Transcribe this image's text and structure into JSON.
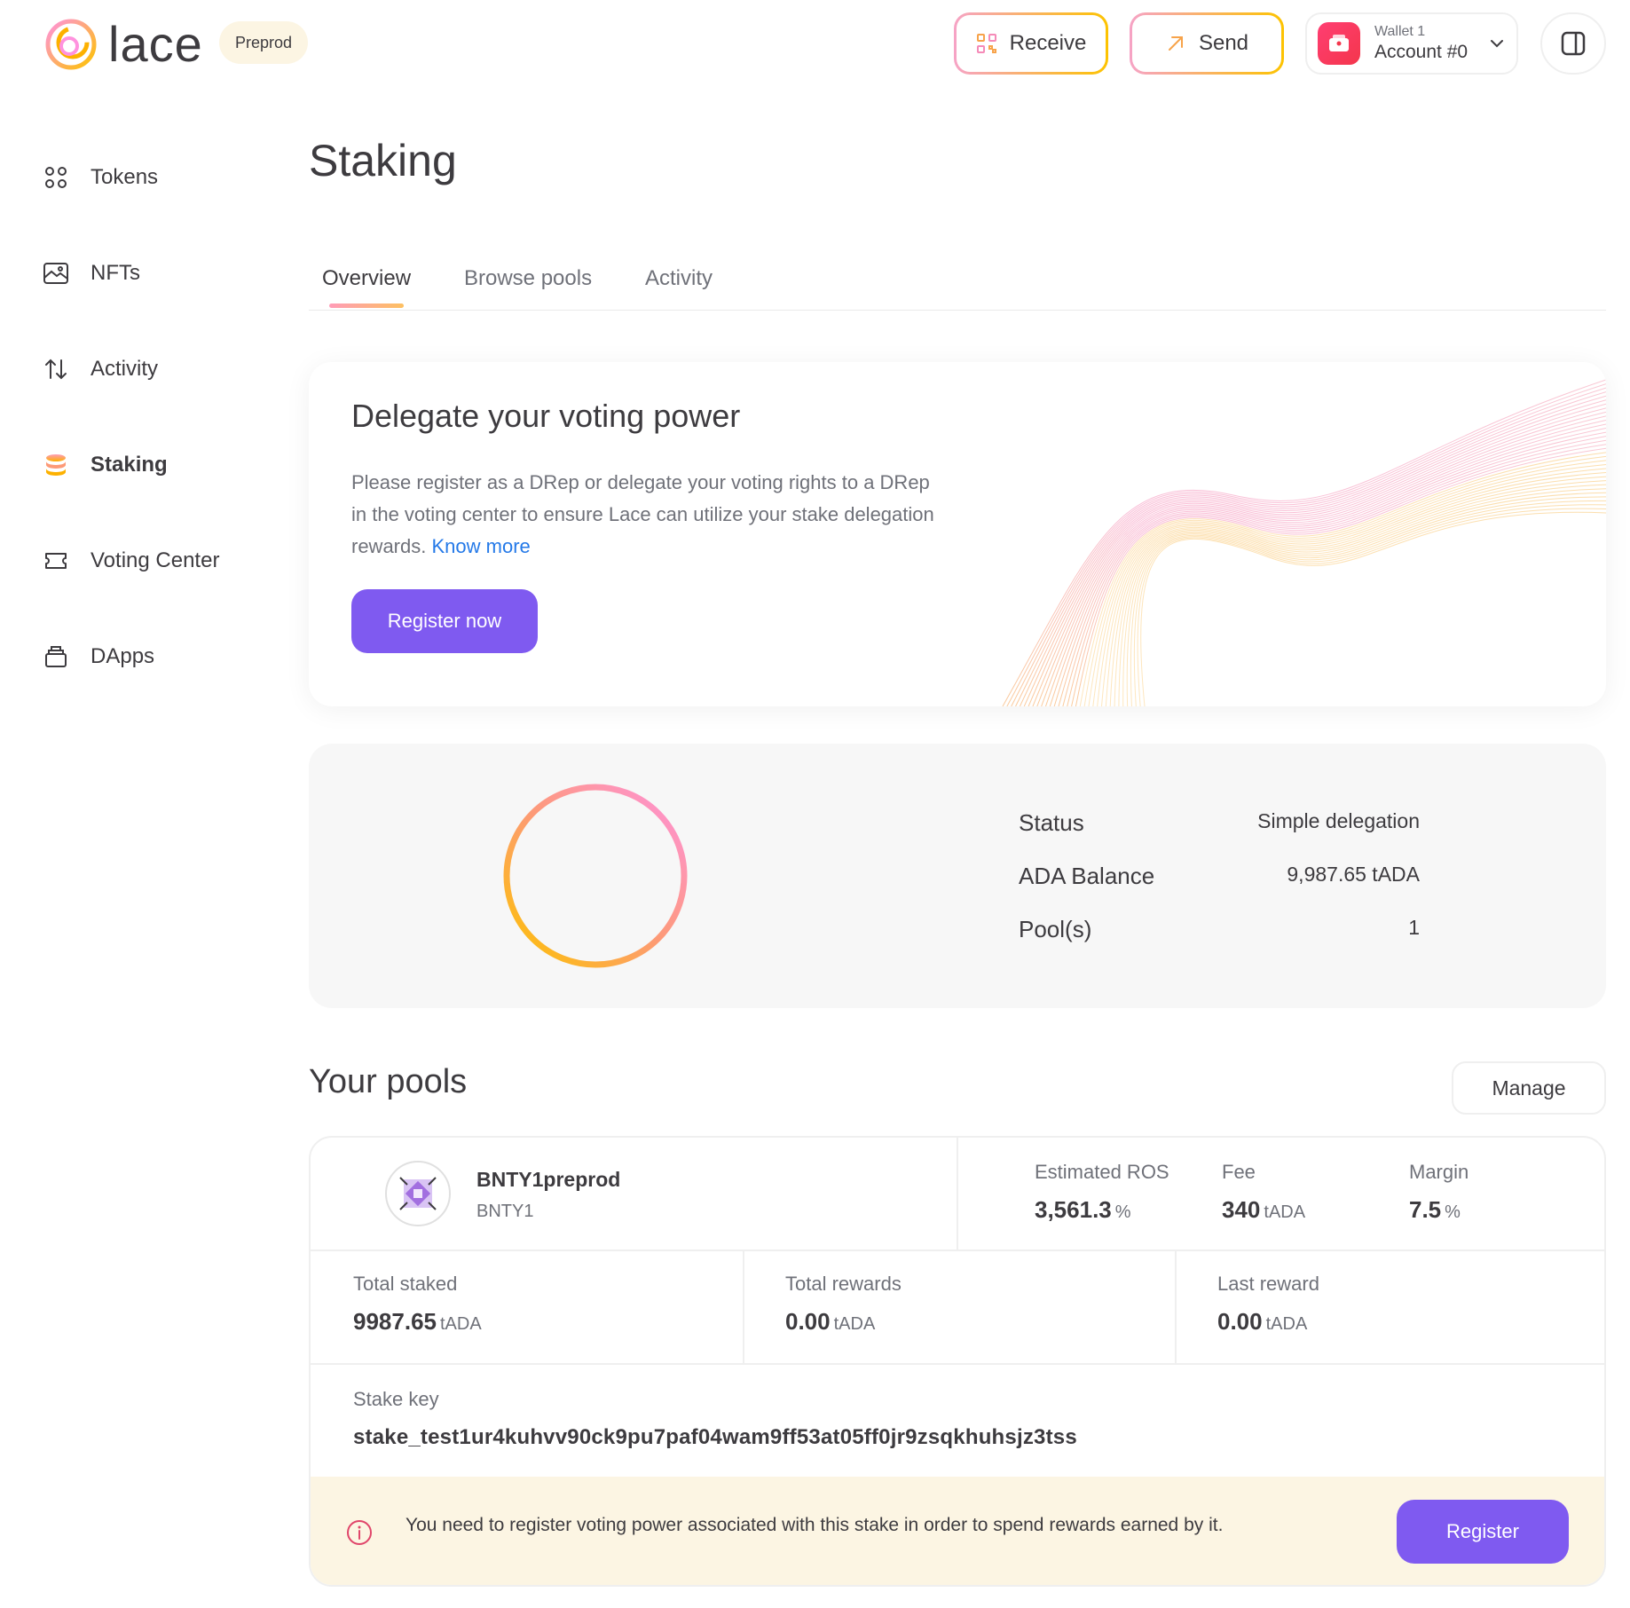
{
  "app": {
    "logo_text": "lace",
    "environment": "Preprod"
  },
  "header": {
    "receive_label": "Receive",
    "send_label": "Send",
    "wallet_name": "Wallet 1",
    "account_name": "Account #0"
  },
  "sidebar": {
    "items": [
      {
        "label": "Tokens",
        "icon": "grid-icon"
      },
      {
        "label": "NFTs",
        "icon": "image-icon"
      },
      {
        "label": "Activity",
        "icon": "arrows-up-down-icon"
      },
      {
        "label": "Staking",
        "icon": "coins-stack-icon",
        "active": true
      },
      {
        "label": "Voting Center",
        "icon": "ticket-icon"
      },
      {
        "label": "DApps",
        "icon": "dapps-icon"
      }
    ]
  },
  "page": {
    "title": "Staking",
    "tabs": [
      {
        "label": "Overview",
        "active": true
      },
      {
        "label": "Browse pools"
      },
      {
        "label": "Activity"
      }
    ]
  },
  "delegate": {
    "title": "Delegate your voting power",
    "description": "Please register as a DRep or delegate your voting rights to a DRep in the voting center to ensure Lace can utilize your stake delegation rewards.",
    "know_more": "Know more",
    "button": "Register now"
  },
  "summary": {
    "status_label": "Status",
    "status_value": "Simple delegation",
    "balance_label": "ADA Balance",
    "balance_value": "9,987.65 tADA",
    "pools_label": "Pool(s)",
    "pools_value": "1"
  },
  "pools": {
    "heading": "Your pools",
    "manage_label": "Manage",
    "pool": {
      "name": "BNTY1preprod",
      "ticker": "BNTY1",
      "ros_label": "Estimated ROS",
      "ros_value": "3,561.3",
      "ros_unit": "%",
      "fee_label": "Fee",
      "fee_value": "340",
      "fee_unit": "tADA",
      "margin_label": "Margin",
      "margin_value": "7.5",
      "margin_unit": "%",
      "total_staked_label": "Total staked",
      "total_staked_value": "9987.65",
      "total_staked_unit": "tADA",
      "total_rewards_label": "Total rewards",
      "total_rewards_value": "0.00",
      "total_rewards_unit": "tADA",
      "last_reward_label": "Last reward",
      "last_reward_value": "0.00",
      "last_reward_unit": "tADA",
      "stake_key_label": "Stake key",
      "stake_key_value": "stake_test1ur4kuhvv90ck9pu7paf04wam9ff53at05ff0jr9zsqkhuhsjz3tss"
    },
    "warning_text": "You need to register voting power associated with this stake in order to spend rewards earned by it.",
    "register_label": "Register"
  },
  "colors": {
    "accent_purple": "#7f5af0",
    "link_blue": "#2479e8",
    "warning_bg": "#fcf5e3",
    "gradient_pink": "#f6a3c6",
    "gradient_yellow": "#fdc300"
  }
}
